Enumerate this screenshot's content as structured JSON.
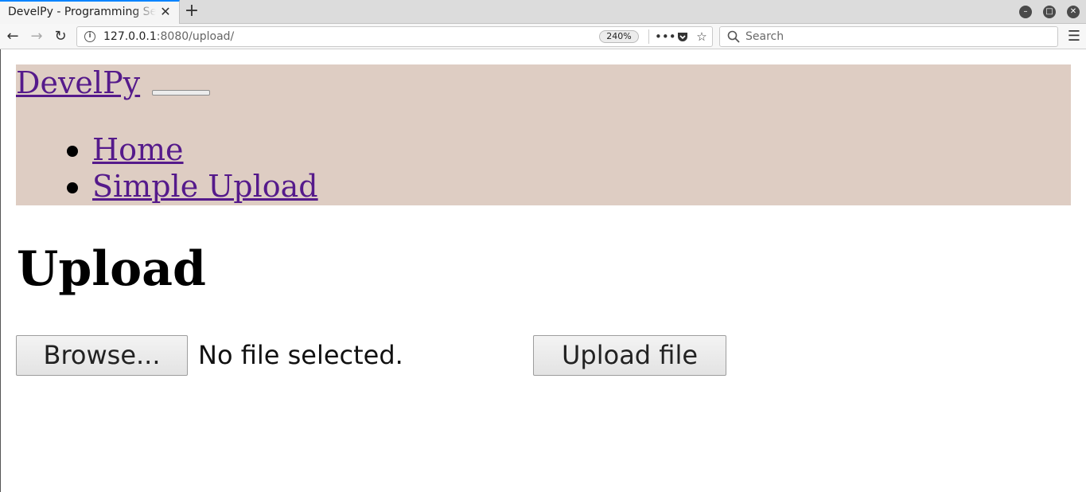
{
  "browser": {
    "tab_title": "DevelPy - Programming Server",
    "url_host": "127.0.0.1",
    "url_rest": ":8080/upload/",
    "zoom": "240%",
    "search_placeholder": "Search"
  },
  "site": {
    "brand": "DevelPy",
    "nav": [
      {
        "label": "Home"
      },
      {
        "label": "Simple Upload"
      }
    ]
  },
  "main": {
    "title": "Upload",
    "browse_label": "Browse...",
    "file_status": "No file selected.",
    "upload_label": "Upload file"
  },
  "colors": {
    "header_bg": "#decdc3",
    "link": "#551a8b",
    "tab_accent": "#0a84ff"
  }
}
